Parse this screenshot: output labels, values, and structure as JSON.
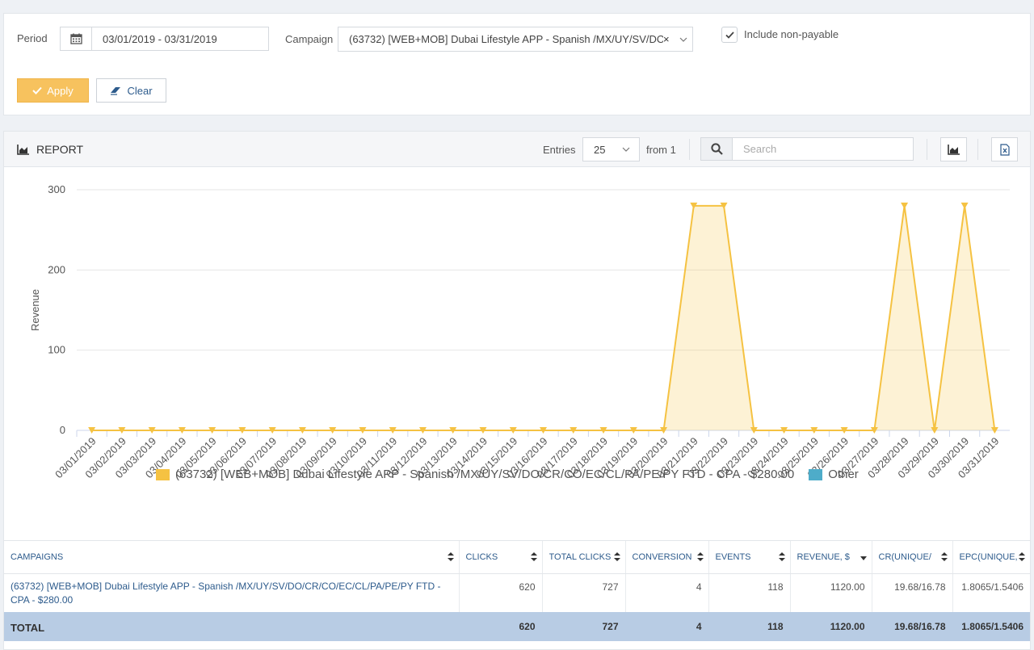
{
  "filters": {
    "period_label": "Period",
    "period_value": "03/01/2019 - 03/31/2019",
    "campaign_label": "Campaign",
    "campaign_value": "(63732) [WEB+MOB] Dubai Lifestyle APP - Spanish /MX/UY/SV/DO...",
    "campaign_clear": "×",
    "include_nonpayable_label": "Include non-payable",
    "include_nonpayable_checked": true,
    "apply_label": "Apply",
    "clear_label": "Clear"
  },
  "report": {
    "title": "REPORT",
    "entries_label": "Entries",
    "entries_value": "25",
    "from_label": "from 1",
    "search_placeholder": "Search"
  },
  "chart_data": {
    "type": "area",
    "ylabel": "Revenue",
    "xlabel": "",
    "ylim": [
      0,
      300
    ],
    "yticks": [
      0,
      100,
      200,
      300
    ],
    "grid": true,
    "x": [
      "03/01/2019",
      "03/02/2019",
      "03/03/2019",
      "03/04/2019",
      "03/05/2019",
      "03/06/2019",
      "03/07/2019",
      "03/08/2019",
      "03/09/2019",
      "03/10/2019",
      "03/11/2019",
      "03/12/2019",
      "03/13/2019",
      "03/14/2019",
      "03/15/2019",
      "03/16/2019",
      "03/17/2019",
      "03/18/2019",
      "03/19/2019",
      "03/20/2019",
      "03/21/2019",
      "03/22/2019",
      "03/23/2019",
      "03/24/2019",
      "03/25/2019",
      "03/26/2019",
      "03/27/2019",
      "03/28/2019",
      "03/29/2019",
      "03/30/2019",
      "03/31/2019"
    ],
    "series": [
      {
        "name": "(63732) [WEB+MOB] Dubai Lifestyle APP - Spanish /MX/UY/SV/DO/CR/CO/EC/CL/PA/PE/PY FTD - CPA - $280.00",
        "color": "#f5c242",
        "values": [
          0,
          0,
          0,
          0,
          0,
          0,
          0,
          0,
          0,
          0,
          0,
          0,
          0,
          0,
          0,
          0,
          0,
          0,
          0,
          0,
          280,
          280,
          0,
          0,
          0,
          0,
          0,
          280,
          0,
          280,
          0
        ]
      },
      {
        "name": "Other",
        "color": "#4eacc9",
        "values": []
      }
    ],
    "legend_position": "bottom"
  },
  "table": {
    "headers": [
      "CAMPAIGNS",
      "CLICKS",
      "TOTAL CLICKS",
      "CONVERSION",
      "EVENTS",
      "REVENUE, $",
      "CR(UNIQUE/",
      "EPC(UNIQUE,"
    ],
    "rows": [
      [
        "(63732) [WEB+MOB] Dubai Lifestyle APP - Spanish /MX/UY/SV/DO/CR/CO/EC/CL/PA/PE/PY FTD - CPA - $280.00",
        "620",
        "727",
        "4",
        "118",
        "1120.00",
        "19.68/16.78",
        "1.8065/1.5406"
      ]
    ],
    "total": [
      "TOTAL",
      "620",
      "727",
      "4",
      "118",
      "1120.00",
      "19.68/16.78",
      "1.8065/1.5406"
    ]
  }
}
